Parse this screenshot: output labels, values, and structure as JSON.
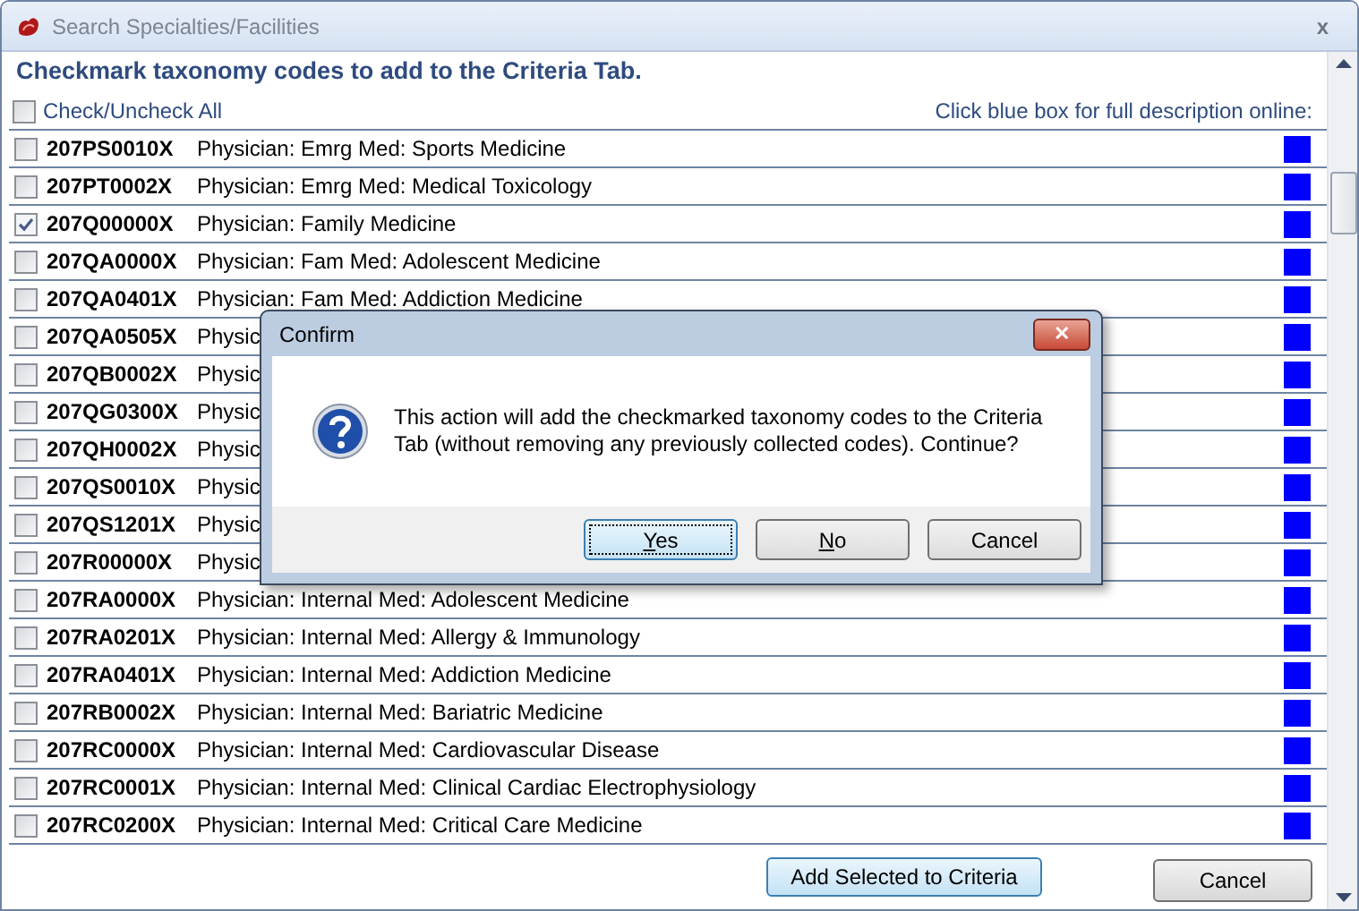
{
  "window": {
    "title": "Search Specialties/Facilities",
    "close": "x"
  },
  "heading": "Checkmark taxonomy codes to add to the Criteria Tab.",
  "check_all": {
    "label": "Check/Uncheck All",
    "checked": false
  },
  "hint": "Click blue box for full description online:",
  "rows": [
    {
      "code": "207PS0010X",
      "description": "Physician: Emrg Med: Sports Medicine",
      "checked": false
    },
    {
      "code": "207PT0002X",
      "description": "Physician: Emrg Med: Medical Toxicology",
      "checked": false
    },
    {
      "code": "207Q00000X",
      "description": "Physician: Family Medicine",
      "checked": true
    },
    {
      "code": "207QA0000X",
      "description": "Physician: Fam Med: Adolescent Medicine",
      "checked": false
    },
    {
      "code": "207QA0401X",
      "description": "Physician: Fam Med: Addiction Medicine",
      "checked": false
    },
    {
      "code": "207QA0505X",
      "description": "Physic",
      "checked": false
    },
    {
      "code": "207QB0002X",
      "description": "Physic",
      "checked": false
    },
    {
      "code": "207QG0300X",
      "description": "Physic",
      "checked": false
    },
    {
      "code": "207QH0002X",
      "description": "Physic",
      "checked": false
    },
    {
      "code": "207QS0010X",
      "description": "Physic",
      "checked": false
    },
    {
      "code": "207QS1201X",
      "description": "Physic",
      "checked": false
    },
    {
      "code": "207R00000X",
      "description": "Physic",
      "checked": false
    },
    {
      "code": "207RA0000X",
      "description": "Physician: Internal Med: Adolescent Medicine",
      "checked": false
    },
    {
      "code": "207RA0201X",
      "description": "Physician: Internal Med: Allergy & Immunology",
      "checked": false
    },
    {
      "code": "207RA0401X",
      "description": "Physician: Internal Med: Addiction Medicine",
      "checked": false
    },
    {
      "code": "207RB0002X",
      "description": "Physician: Internal Med: Bariatric Medicine",
      "checked": false
    },
    {
      "code": "207RC0000X",
      "description": "Physician: Internal Med: Cardiovascular Disease",
      "checked": false
    },
    {
      "code": "207RC0001X",
      "description": "Physician: Internal Med: Clinical Cardiac Electrophysiology",
      "checked": false
    },
    {
      "code": "207RC0200X",
      "description": "Physician: Internal Med: Critical Care Medicine",
      "checked": false
    }
  ],
  "buttons": [
    {
      "label": "Add Selected to Criteria",
      "kind": "primary"
    },
    {
      "label": "Cancel",
      "kind": "cancel"
    }
  ],
  "dialog": {
    "title": "Confirm",
    "close": "✕",
    "message": "This action will add the checkmarked taxonomy codes to the Criteria Tab (without removing any previously collected codes). Continue?",
    "buttons": [
      {
        "label": "Yes",
        "mnemonic": true,
        "focused": true
      },
      {
        "label": "No",
        "mnemonic": true,
        "focused": false
      },
      {
        "label": "Cancel",
        "mnemonic": false,
        "focused": false
      }
    ]
  }
}
